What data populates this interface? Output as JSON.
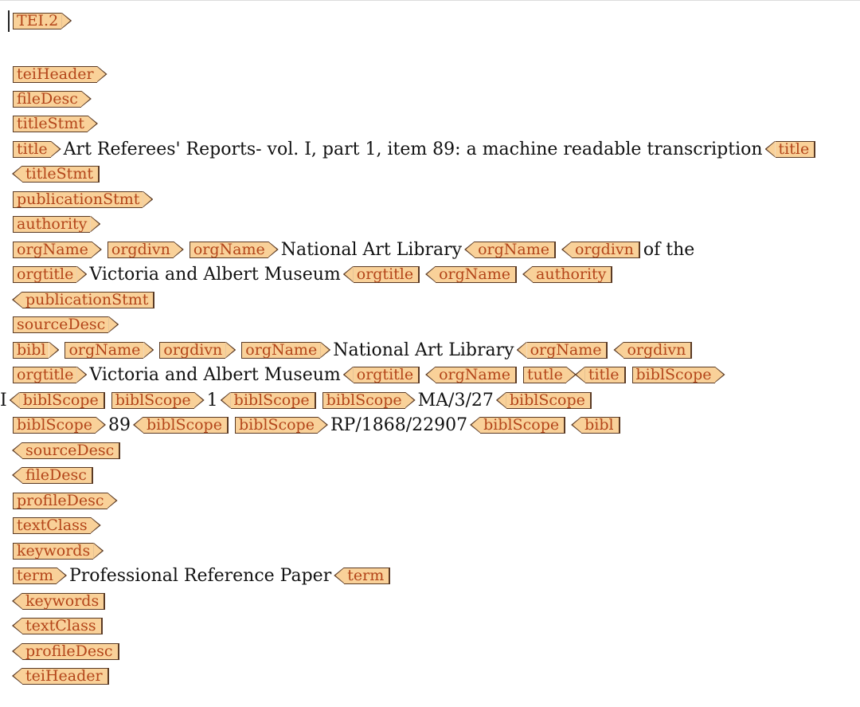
{
  "tags": {
    "tei2": "TEI.2",
    "teiHeader": "teiHeader",
    "fileDesc": "fileDesc",
    "titleStmt": "titleStmt",
    "title": "title",
    "title_lower": "tutle",
    "publicationStmt": "publicationStmt",
    "authority": "authority",
    "orgName": "orgName",
    "orgdivn": "orgdivn",
    "orgtitle": "orgtitle",
    "sourceDesc": "sourceDesc",
    "bibl": "bibl",
    "biblScope": "biblScope",
    "profileDesc": "profileDesc",
    "textClass": "textClass",
    "keywords": "keywords",
    "term": "term"
  },
  "texts": {
    "doc_title": "Art Referees' Reports- vol. I, part 1, item 89: a machine readable transcription",
    "nal": "National Art Library",
    "of_the": "of the",
    "vam": "Victoria and Albert Museum",
    "roman_one": "I",
    "scope_part": "1",
    "scope_shelf": "MA/3/27",
    "scope_item": "89",
    "scope_rp": "RP/1868/22907",
    "term_value": "Professional Reference Paper"
  },
  "colors": {
    "tag_fill": "#f9d199",
    "tag_text": "#b3451a",
    "tag_border": "#5a3a24",
    "body_text": "#111111",
    "background": "#ffffff"
  }
}
